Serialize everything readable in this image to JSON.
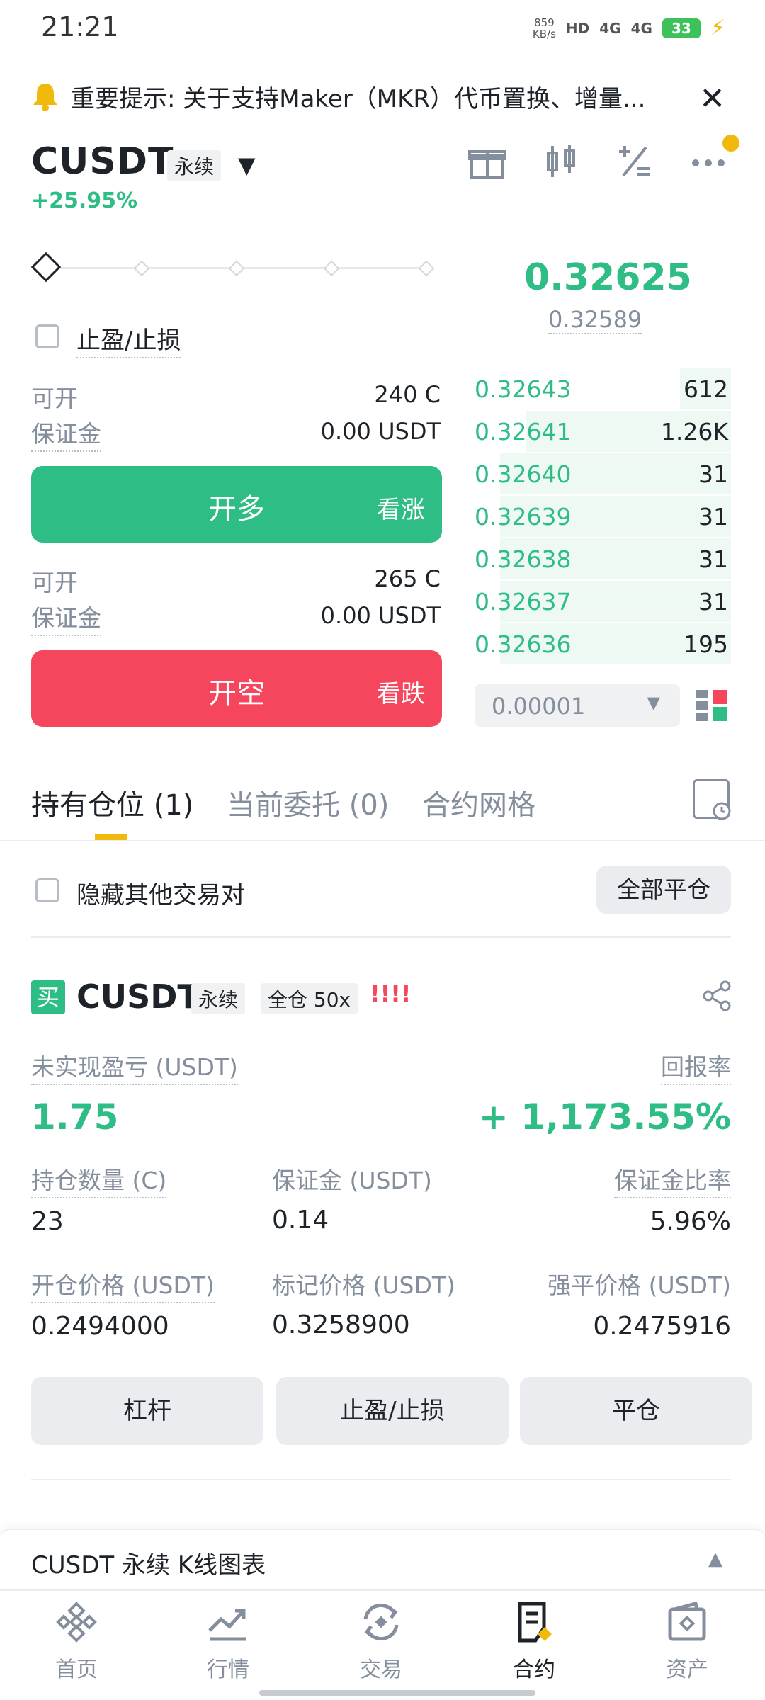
{
  "status_bar": {
    "time": "21:21",
    "net_speed_value": "859",
    "net_speed_unit": "KB/s",
    "hd": "HD",
    "sig1": "4G",
    "sig2": "4G",
    "battery": "33"
  },
  "notice": {
    "icon": "bell-icon",
    "text": "重要提示: 关于支持Maker（MKR）代币置换、增量..."
  },
  "pair": {
    "name": "CUSDT",
    "type_tag": "永续",
    "change": "+25.95%"
  },
  "order_form": {
    "tpsl_label": "止盈/止损",
    "long": {
      "avail_label": "可开",
      "avail_value": "240 C",
      "margin_label": "保证金",
      "margin_value": "0.00 USDT",
      "button_main": "开多",
      "button_sub": "看涨"
    },
    "short": {
      "avail_label": "可开",
      "avail_value": "265 C",
      "margin_label": "保证金",
      "margin_value": "0.00 USDT",
      "button_main": "开空",
      "button_sub": "看跌"
    }
  },
  "order_book": {
    "last_price": "0.32625",
    "mark_price": "0.32589",
    "rows": [
      {
        "price": "0.32643",
        "qty": "612",
        "depth": 0.2
      },
      {
        "price": "0.32641",
        "qty": "1.26K",
        "depth": 0.8
      },
      {
        "price": "0.32640",
        "qty": "31",
        "depth": 0.9
      },
      {
        "price": "0.32639",
        "qty": "31",
        "depth": 0.9
      },
      {
        "price": "0.32638",
        "qty": "31",
        "depth": 0.9
      },
      {
        "price": "0.32637",
        "qty": "31",
        "depth": 0.9
      },
      {
        "price": "0.32636",
        "qty": "195",
        "depth": 0.9
      }
    ],
    "precision": "0.00001"
  },
  "tabs": [
    {
      "label": "持有仓位 (1)",
      "active": true
    },
    {
      "label": "当前委托 (0)",
      "active": false
    },
    {
      "label": "合约网格",
      "active": false
    }
  ],
  "positions": {
    "hide_others_label": "隐藏其他交易对",
    "close_all_label": "全部平仓",
    "card": {
      "side_badge": "买",
      "symbol": "CUSDT",
      "type_tag": "永续",
      "margin_mode_tag": "全仓 50x",
      "warning": "!!!!",
      "pnl_label": "未实现盈亏 (USDT)",
      "pnl_value": "1.75",
      "roe_label": "回报率",
      "roe_value": "+ 1,173.55%",
      "size_label": "持仓数量 (C)",
      "size_value": "23",
      "margin_label": "保证金 (USDT)",
      "margin_value": "0.14",
      "margin_ratio_label": "保证金比率",
      "margin_ratio_value": "5.96%",
      "entry_label": "开仓价格 (USDT)",
      "entry_value": "0.2494000",
      "mark_label": "标记价格 (USDT)",
      "mark_value": "0.3258900",
      "liq_label": "强平价格 (USDT)",
      "liq_value": "0.2475916",
      "actions": [
        "杠杆",
        "止盈/止损",
        "平仓"
      ]
    }
  },
  "kline": {
    "title": "CUSDT 永续 K线图表"
  },
  "bottom_nav": [
    {
      "label": "首页",
      "icon": "home-logo-icon",
      "active": false
    },
    {
      "label": "行情",
      "icon": "markets-chart-icon",
      "active": false
    },
    {
      "label": "交易",
      "icon": "trade-icon",
      "active": false
    },
    {
      "label": "合约",
      "icon": "futures-icon",
      "active": true
    },
    {
      "label": "资产",
      "icon": "wallet-icon",
      "active": false
    }
  ],
  "colors": {
    "green": "#2ebd85",
    "red": "#f6465d",
    "accent": "#f0b90b",
    "muted": "#848e9c"
  }
}
